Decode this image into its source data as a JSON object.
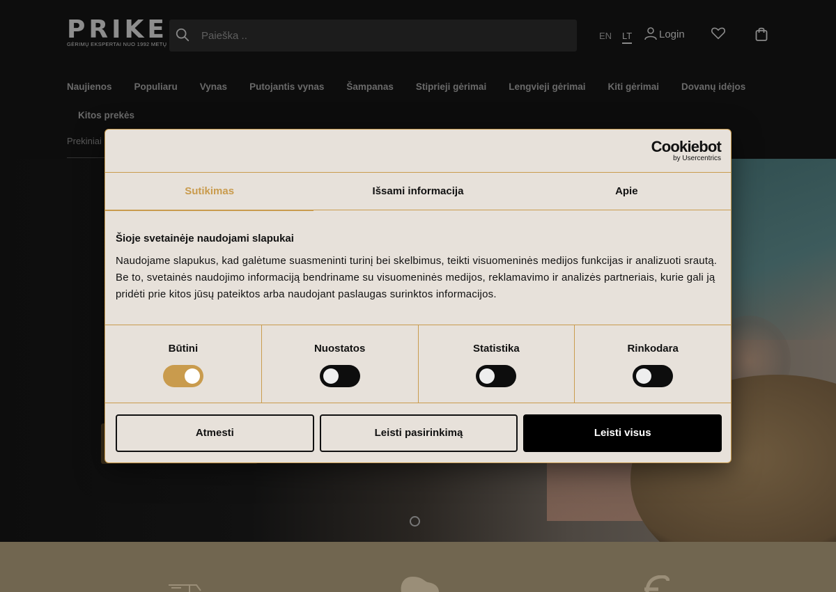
{
  "header": {
    "logo": {
      "word": "PRIKE",
      "tagline": "GĖRIMŲ EKSPERTAI NUO 1992 METŲ"
    },
    "search": {
      "placeholder": "Paieška .."
    },
    "lang": {
      "en": "EN",
      "lt": "LT",
      "active": "LT"
    },
    "login_label": "Login",
    "nav": [
      "Naujienos",
      "Populiaru",
      "Vynas",
      "Putojantis vynas",
      "Šampanas",
      "Stiprieji gėrimai",
      "Lengvieji gėrimai",
      "Kiti gėrimai",
      "Dovanų idėjos"
    ],
    "nav_row2": "Kitos prekės",
    "brands_label": "Prekiniai"
  },
  "cookie": {
    "brand": "Cookiebot",
    "brand_sub": "by Usercentrics",
    "tabs": [
      "Sutikimas",
      "Išsami informacija",
      "Apie"
    ],
    "active_tab": "Sutikimas",
    "title": "Šioje svetainėje naudojami slapukai",
    "body": "Naudojame slapukus, kad galėtume suasmeninti turinį bei skelbimus, teikti visuomeninės medijos funkcijas ir analizuoti srautą. Be to, svetainės naudojimo informaciją bendriname su visuomeninės medijos, reklamavimo ir analizės partneriais, kurie gali ją pridėti prie kitos jūsų pateiktos arba naudojant paslaugas surinktos informacijos.",
    "toggles": [
      {
        "label": "Būtini",
        "on": true
      },
      {
        "label": "Nuostatos",
        "on": false
      },
      {
        "label": "Statistika",
        "on": false
      },
      {
        "label": "Rinkodara",
        "on": false
      }
    ],
    "buttons": {
      "reject": "Atmesti",
      "allow_selection": "Leisti pasirinkimą",
      "allow_all": "Leisti visus"
    }
  },
  "colors": {
    "accent": "#c99b4d",
    "dialog_bg": "#e7e1da",
    "header_bg": "#0d0d0d",
    "features_bg": "#716650"
  }
}
